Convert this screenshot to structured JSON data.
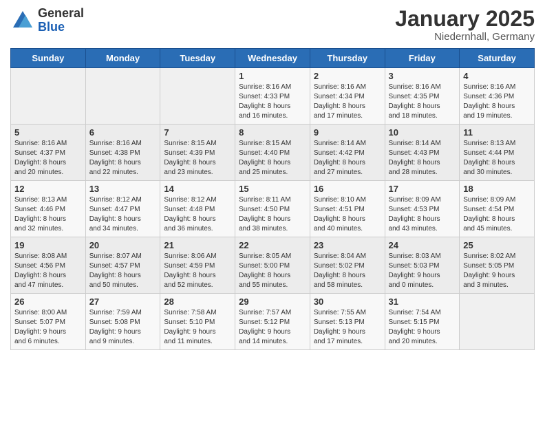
{
  "header": {
    "logo_general": "General",
    "logo_blue": "Blue",
    "month_title": "January 2025",
    "location": "Niedernhall, Germany"
  },
  "weekdays": [
    "Sunday",
    "Monday",
    "Tuesday",
    "Wednesday",
    "Thursday",
    "Friday",
    "Saturday"
  ],
  "weeks": [
    [
      {
        "day": "",
        "info": ""
      },
      {
        "day": "",
        "info": ""
      },
      {
        "day": "",
        "info": ""
      },
      {
        "day": "1",
        "info": "Sunrise: 8:16 AM\nSunset: 4:33 PM\nDaylight: 8 hours\nand 16 minutes."
      },
      {
        "day": "2",
        "info": "Sunrise: 8:16 AM\nSunset: 4:34 PM\nDaylight: 8 hours\nand 17 minutes."
      },
      {
        "day": "3",
        "info": "Sunrise: 8:16 AM\nSunset: 4:35 PM\nDaylight: 8 hours\nand 18 minutes."
      },
      {
        "day": "4",
        "info": "Sunrise: 8:16 AM\nSunset: 4:36 PM\nDaylight: 8 hours\nand 19 minutes."
      }
    ],
    [
      {
        "day": "5",
        "info": "Sunrise: 8:16 AM\nSunset: 4:37 PM\nDaylight: 8 hours\nand 20 minutes."
      },
      {
        "day": "6",
        "info": "Sunrise: 8:16 AM\nSunset: 4:38 PM\nDaylight: 8 hours\nand 22 minutes."
      },
      {
        "day": "7",
        "info": "Sunrise: 8:15 AM\nSunset: 4:39 PM\nDaylight: 8 hours\nand 23 minutes."
      },
      {
        "day": "8",
        "info": "Sunrise: 8:15 AM\nSunset: 4:40 PM\nDaylight: 8 hours\nand 25 minutes."
      },
      {
        "day": "9",
        "info": "Sunrise: 8:14 AM\nSunset: 4:42 PM\nDaylight: 8 hours\nand 27 minutes."
      },
      {
        "day": "10",
        "info": "Sunrise: 8:14 AM\nSunset: 4:43 PM\nDaylight: 8 hours\nand 28 minutes."
      },
      {
        "day": "11",
        "info": "Sunrise: 8:13 AM\nSunset: 4:44 PM\nDaylight: 8 hours\nand 30 minutes."
      }
    ],
    [
      {
        "day": "12",
        "info": "Sunrise: 8:13 AM\nSunset: 4:46 PM\nDaylight: 8 hours\nand 32 minutes."
      },
      {
        "day": "13",
        "info": "Sunrise: 8:12 AM\nSunset: 4:47 PM\nDaylight: 8 hours\nand 34 minutes."
      },
      {
        "day": "14",
        "info": "Sunrise: 8:12 AM\nSunset: 4:48 PM\nDaylight: 8 hours\nand 36 minutes."
      },
      {
        "day": "15",
        "info": "Sunrise: 8:11 AM\nSunset: 4:50 PM\nDaylight: 8 hours\nand 38 minutes."
      },
      {
        "day": "16",
        "info": "Sunrise: 8:10 AM\nSunset: 4:51 PM\nDaylight: 8 hours\nand 40 minutes."
      },
      {
        "day": "17",
        "info": "Sunrise: 8:09 AM\nSunset: 4:53 PM\nDaylight: 8 hours\nand 43 minutes."
      },
      {
        "day": "18",
        "info": "Sunrise: 8:09 AM\nSunset: 4:54 PM\nDaylight: 8 hours\nand 45 minutes."
      }
    ],
    [
      {
        "day": "19",
        "info": "Sunrise: 8:08 AM\nSunset: 4:56 PM\nDaylight: 8 hours\nand 47 minutes."
      },
      {
        "day": "20",
        "info": "Sunrise: 8:07 AM\nSunset: 4:57 PM\nDaylight: 8 hours\nand 50 minutes."
      },
      {
        "day": "21",
        "info": "Sunrise: 8:06 AM\nSunset: 4:59 PM\nDaylight: 8 hours\nand 52 minutes."
      },
      {
        "day": "22",
        "info": "Sunrise: 8:05 AM\nSunset: 5:00 PM\nDaylight: 8 hours\nand 55 minutes."
      },
      {
        "day": "23",
        "info": "Sunrise: 8:04 AM\nSunset: 5:02 PM\nDaylight: 8 hours\nand 58 minutes."
      },
      {
        "day": "24",
        "info": "Sunrise: 8:03 AM\nSunset: 5:03 PM\nDaylight: 9 hours\nand 0 minutes."
      },
      {
        "day": "25",
        "info": "Sunrise: 8:02 AM\nSunset: 5:05 PM\nDaylight: 9 hours\nand 3 minutes."
      }
    ],
    [
      {
        "day": "26",
        "info": "Sunrise: 8:00 AM\nSunset: 5:07 PM\nDaylight: 9 hours\nand 6 minutes."
      },
      {
        "day": "27",
        "info": "Sunrise: 7:59 AM\nSunset: 5:08 PM\nDaylight: 9 hours\nand 9 minutes."
      },
      {
        "day": "28",
        "info": "Sunrise: 7:58 AM\nSunset: 5:10 PM\nDaylight: 9 hours\nand 11 minutes."
      },
      {
        "day": "29",
        "info": "Sunrise: 7:57 AM\nSunset: 5:12 PM\nDaylight: 9 hours\nand 14 minutes."
      },
      {
        "day": "30",
        "info": "Sunrise: 7:55 AM\nSunset: 5:13 PM\nDaylight: 9 hours\nand 17 minutes."
      },
      {
        "day": "31",
        "info": "Sunrise: 7:54 AM\nSunset: 5:15 PM\nDaylight: 9 hours\nand 20 minutes."
      },
      {
        "day": "",
        "info": ""
      }
    ]
  ]
}
